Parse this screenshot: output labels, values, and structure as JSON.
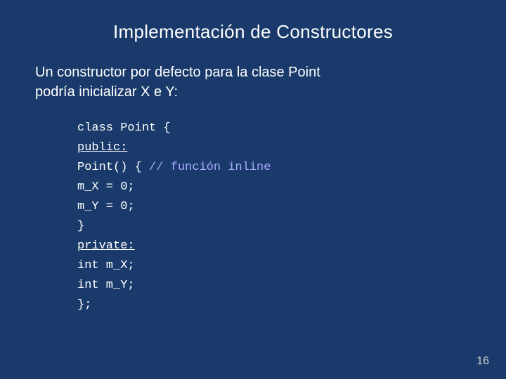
{
  "slide": {
    "title": "Implementación de Constructores",
    "intro_line1": "Un constructor por defecto para la clase Point",
    "intro_line2": "podría inicializar X e Y:",
    "code": {
      "line1": "class Point {",
      "line2": "public:",
      "line3": "  Point() {",
      "line3_comment": "  // función inline",
      "line4": "    m_X = 0;",
      "line5": "    m_Y = 0;",
      "line6": "  }",
      "line7": "private:",
      "line8": "  int m_X;",
      "line9": "  int m_Y;",
      "line10": "};"
    },
    "page_number": "16"
  }
}
